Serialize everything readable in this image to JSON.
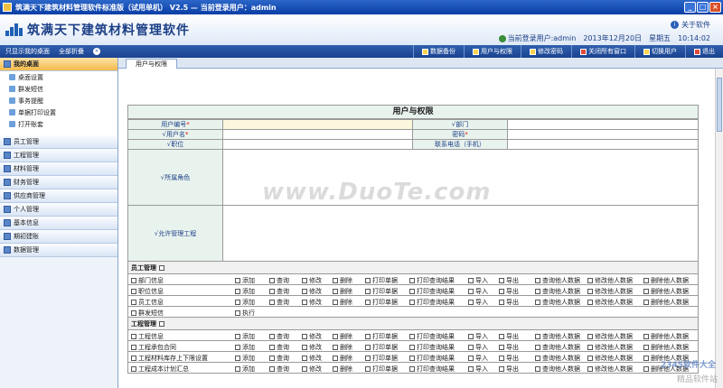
{
  "window": {
    "title": "筑满天下建筑材料管理软件标准版（试用单机） V2.5 — 当前登录用户：admin"
  },
  "header": {
    "app_name": "筑满天下建筑材料管理软件",
    "about": "关于软件",
    "current_user": "当前登录用户:admin",
    "date": "2013年12月20日",
    "weekday": "星期五",
    "time": "10:14:02"
  },
  "toolbar": {
    "left": [
      "只显示我的桌面",
      "全部折叠"
    ],
    "buttons": [
      "数据备份",
      "用户与权限",
      "修改密码",
      "关闭所有窗口",
      "切换用户",
      "退出"
    ]
  },
  "sidebar": {
    "groups": [
      "我的桌面",
      "员工管理",
      "工程管理",
      "材料管理",
      "财务管理",
      "供应商管理",
      "个人管理",
      "基本信息",
      "期初建账",
      "数据管理"
    ],
    "desktop_items": [
      "桌面设置",
      "群发短信",
      "事务提醒",
      "单据打印设置",
      "打开账套"
    ]
  },
  "tabs": [
    "用户与权限"
  ],
  "form": {
    "title": "用户与权限",
    "user_no": "用户编号",
    "department": "部门",
    "username": "用户名",
    "password": "密码",
    "position": "职位",
    "phone": "联系电话（手机）",
    "roles": "所属角色",
    "allowed_projects": "允许管理工程",
    "required_mark": "*",
    "check_mark": "√"
  },
  "permissions": {
    "actions": [
      "添加",
      "查询",
      "修改",
      "删除",
      "打印单据",
      "打印查询结果",
      "导入",
      "导出",
      "查询他人数据",
      "修改他人数据",
      "删除他人数据"
    ],
    "groups": [
      {
        "name": "员工管理",
        "rows": [
          {
            "name": "部门信息",
            "actions": [
              0,
              1,
              2,
              3,
              4,
              5,
              6,
              7,
              8,
              9,
              10
            ]
          },
          {
            "name": "职位信息",
            "actions": [
              0,
              1,
              2,
              3,
              4,
              5,
              6,
              7,
              8,
              9,
              10
            ]
          },
          {
            "name": "员工信息",
            "actions": [
              0,
              1,
              2,
              3,
              4,
              5,
              6,
              7,
              8,
              9,
              10
            ]
          },
          {
            "name": "群发短信",
            "actions": [],
            "extra": "执行"
          }
        ]
      },
      {
        "name": "工程管理",
        "rows": [
          {
            "name": "工程信息",
            "actions": [
              0,
              1,
              2,
              3,
              4,
              5,
              6,
              7,
              8,
              9,
              10
            ]
          },
          {
            "name": "工程承包合同",
            "actions": [
              0,
              1,
              2,
              3,
              4,
              5,
              6,
              7,
              8,
              9,
              10
            ]
          },
          {
            "name": "工程材料库存上下限设置",
            "actions": [
              0,
              1,
              2,
              3,
              4,
              5,
              6,
              7,
              8,
              9,
              10
            ]
          },
          {
            "name": "工程成本计划汇总",
            "actions": [
              0,
              1,
              2,
              3,
              4,
              5,
              6,
              7,
              8,
              9,
              10
            ]
          }
        ]
      }
    ]
  },
  "watermark": "www.DuoTe.com",
  "brand": "2345软件大全",
  "brand2": "精品软件站"
}
